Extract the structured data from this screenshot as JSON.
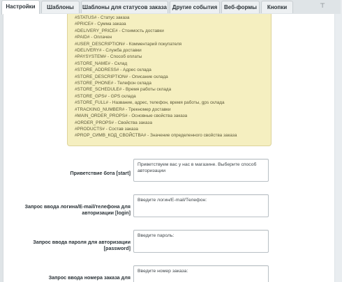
{
  "tabs": [
    {
      "label": "Настройки"
    },
    {
      "label": "Шаблоны"
    },
    {
      "label": "Шаблоны для статусов заказа"
    },
    {
      "label": "Другие события"
    },
    {
      "label": "Веб-формы"
    },
    {
      "label": "Кнопки"
    }
  ],
  "pin_icon": "pin-icon",
  "variables": [
    "#STATUS# - Статус заказа",
    "#PRICE# - Сумма заказа",
    "#DELIVERY_PRICE# - Стоимость доставки",
    "#PAID# - Оплачен",
    "#USER_DESCRIPTION# - Комментарий покупателя",
    "#DELIVERY# - Служба доставки",
    "#PAYSYSTEM# - Способ оплаты",
    "#STORE_NAME# - Склад",
    "#STORE_ADDRESS# - Адрес склада",
    "#STORE_DESCRIPTION# - Описание склада",
    "#STORE_PHONE# - Телефон склада",
    "#STORE_SCHEDULE# - Время работы склада",
    "#STORE_GPS# - GPS склада",
    "#STORE_FULL# - Название, адрес, телефон, время работы, gps склада",
    "#TRACKING_NUMBER# - Трекномер доставки",
    "#MAIN_ORDER_PROPS# - Основные свойства заказа",
    "#ORDER_PROPS# - Свойства заказа",
    "#PRODUCTS# - Состав заказа",
    "#PROP_СИМВ_КОД_СВОЙСТВА# - Значение определенного свойства заказа"
  ],
  "fields": [
    {
      "label": "Приветствие бота [start]",
      "value": "Приветствуем вас у нас в магазине. Выберите способ авторизации"
    },
    {
      "label": "Запрос ввода логина/E-mail/телефона для авторизации [login]",
      "value": "Введите логин/E-mail/Телефон:"
    },
    {
      "label": "Запрос ввода пароля для авторизации [password]",
      "value": "Введите пароль:"
    },
    {
      "label": "Запрос ввода номера заказа для",
      "value": "Введите номер заказа:"
    }
  ]
}
